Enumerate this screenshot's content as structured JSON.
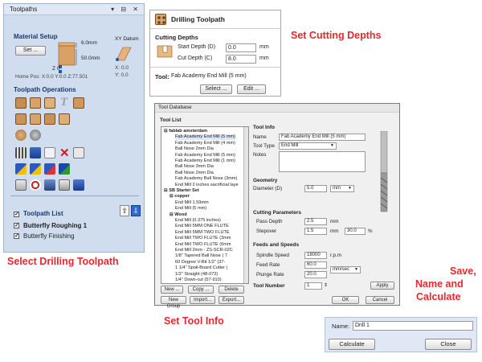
{
  "toolpaths_panel": {
    "title": "Toolpaths",
    "window_controls": "▾ ⊟ ✕",
    "material_setup": {
      "heading": "Material Setup",
      "set_button": "Set ...",
      "dim1": "6.0mm",
      "dim2": "50.0mm",
      "z_zero": "Z 0",
      "xy_datum": "XY Datum",
      "x_value": "X: 0.0",
      "y_value": "Y: 0.0",
      "home_pos": "Home Pos:  X:0.0 Y:0.0 Z:77.501"
    },
    "operations_heading": "Toolpath Operations",
    "list_heading": "Toolpath List",
    "list_items": [
      {
        "label": "Butterfly Roughing 1",
        "checked": true
      },
      {
        "label": "Butterfly Finishing",
        "checked": true
      }
    ]
  },
  "drilling_panel": {
    "title": "Drilling Toolpath",
    "cutting_depths_heading": "Cutting Depths",
    "start_depth_label": "Start Depth (D)",
    "start_depth_value": "0.0",
    "cut_depth_label": "Cut Depth (C)",
    "cut_depth_value": "8.0",
    "unit": "mm",
    "tool_label": "Tool:",
    "tool_name": "Fab Academy End Mill (5 mm)",
    "select_button": "Select ...",
    "edit_button": "Edit ..."
  },
  "tool_database": {
    "title": "Tool Database",
    "tool_list_heading": "Tool List",
    "tree": [
      {
        "text": "⊟ fablab amsterdam",
        "level": 0,
        "bold": true
      },
      {
        "text": "Fab Academy End Mill (5 mm)",
        "level": 2,
        "bold": false
      },
      {
        "text": "Fab Academy End Mill (4 mm)",
        "level": 2,
        "bold": false
      },
      {
        "text": "Ball Nose 2mm Dia",
        "level": 2,
        "bold": false
      },
      {
        "text": "Fab Academy End Mill (5 mm)",
        "level": 2,
        "bold": false
      },
      {
        "text": "Fab Academy End Mill (1 mm)",
        "level": 2,
        "bold": false
      },
      {
        "text": "Ball Nose 3mm Dia",
        "level": 2,
        "bold": false
      },
      {
        "text": "Ball Nose 2mm Dia",
        "level": 2,
        "bold": false
      },
      {
        "text": "Fab Academy Ball Nose (3mm)",
        "level": 2,
        "bold": false
      },
      {
        "text": "End Mill 2 inches sacrificial laye",
        "level": 2,
        "bold": false
      },
      {
        "text": "⊟ SB Starter Set",
        "level": 0,
        "bold": true
      },
      {
        "text": "⊟ copper",
        "level": 1,
        "bold": true
      },
      {
        "text": "End Mill 1.59mm",
        "level": 2,
        "bold": false
      },
      {
        "text": "End Mill (5 mm)",
        "level": 2,
        "bold": false
      },
      {
        "text": "⊟ Wood",
        "level": 1,
        "bold": true
      },
      {
        "text": "End Mill (0.375 inches)",
        "level": 2,
        "bold": false
      },
      {
        "text": "End Mill 5MM ONE FLUTE",
        "level": 2,
        "bold": false
      },
      {
        "text": "End Mill 5MM TWO FLUTE",
        "level": 2,
        "bold": false
      },
      {
        "text": "End Mill TWO FLUTE (3mm",
        "level": 2,
        "bold": false
      },
      {
        "text": "End Mill TWO FLUTE (6mm",
        "level": 2,
        "bold": false
      },
      {
        "text": "End Mill 2mm - ZS-SCR-02C",
        "level": 2,
        "bold": false
      },
      {
        "text": "1/8\" Tapered Ball Nose ( 7",
        "level": 2,
        "bold": false
      },
      {
        "text": "60 Degree V-Bit 1/2\" (37-",
        "level": 2,
        "bold": false
      },
      {
        "text": "1 1/4\" Spoil-Board Cutter (",
        "level": 2,
        "bold": false
      },
      {
        "text": "1/2\" Straight (48-072)",
        "level": 2,
        "bold": false
      },
      {
        "text": "1/4\" Down-cut (57-910)",
        "level": 2,
        "bold": false
      }
    ],
    "tool_info_heading": "Tool Info",
    "name_label": "Name",
    "name_value": "Fab Academy End Mill (5 mm)",
    "tool_type_label": "Tool Type",
    "tool_type_value": "End Mill",
    "notes_label": "Notes",
    "geometry_heading": "Geometry",
    "diameter_label": "Diameter (D)",
    "diameter_value": "5.0",
    "diameter_unit": "mm",
    "cutting_params_heading": "Cutting Parameters",
    "pass_depth_label": "Pass Depth",
    "pass_depth_value": "2.5",
    "pass_depth_unit": "mm",
    "stepover_label": "Stepover",
    "stepover_value": "1.5",
    "stepover_unit": "mm",
    "stepover_pct": "30.0",
    "pct_sign": "%",
    "feeds_heading": "Feeds and Speeds",
    "spindle_label": "Spindle Speed",
    "spindle_value": "18000",
    "spindle_unit": "r.p.m",
    "feed_label": "Feed Rate",
    "feed_value": "60.0",
    "plunge_label": "Plunge Rate",
    "plunge_value": "20.0",
    "rate_unit": "mm/sec",
    "tool_number_label": "Tool Number",
    "tool_number_value": "1",
    "apply_button": "Apply",
    "new_button": "New ...",
    "copy_button": "Copy ...",
    "delete_button": "Delete",
    "new_group_button": "New Group",
    "import_button": "Import...",
    "export_button": "Export...",
    "ok_button": "OK",
    "cancel_button": "Cancel"
  },
  "save_panel": {
    "name_label": "Name:",
    "name_value": "Drill 1",
    "calculate_button": "Calculate",
    "close_button": "Close"
  },
  "captions": {
    "set_cutting_depths": "Set Cutting Depths",
    "select_drilling": "Select Drilling Toolpath",
    "set_tool_info": "Set Tool Info",
    "save_line1": "Save,",
    "save_line2": "Name and",
    "save_line3": "Calculate"
  },
  "colors": {
    "caption_red": "#e8282a",
    "panel_blue": "#cfddef",
    "heading_blue": "#1a3a6e"
  }
}
